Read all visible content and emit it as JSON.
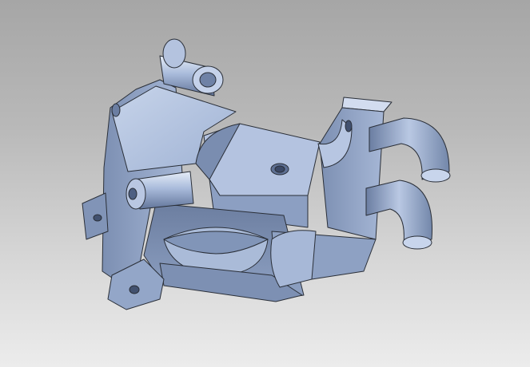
{
  "viewport": {
    "background_top": "#a6a6a6",
    "background_bottom": "#ececec"
  },
  "model": {
    "part_color": "#9fb3d6",
    "shadow_color": "#5d6f90",
    "highlight_color": "#dfe7f5",
    "edge_color": "#2a2f38"
  }
}
